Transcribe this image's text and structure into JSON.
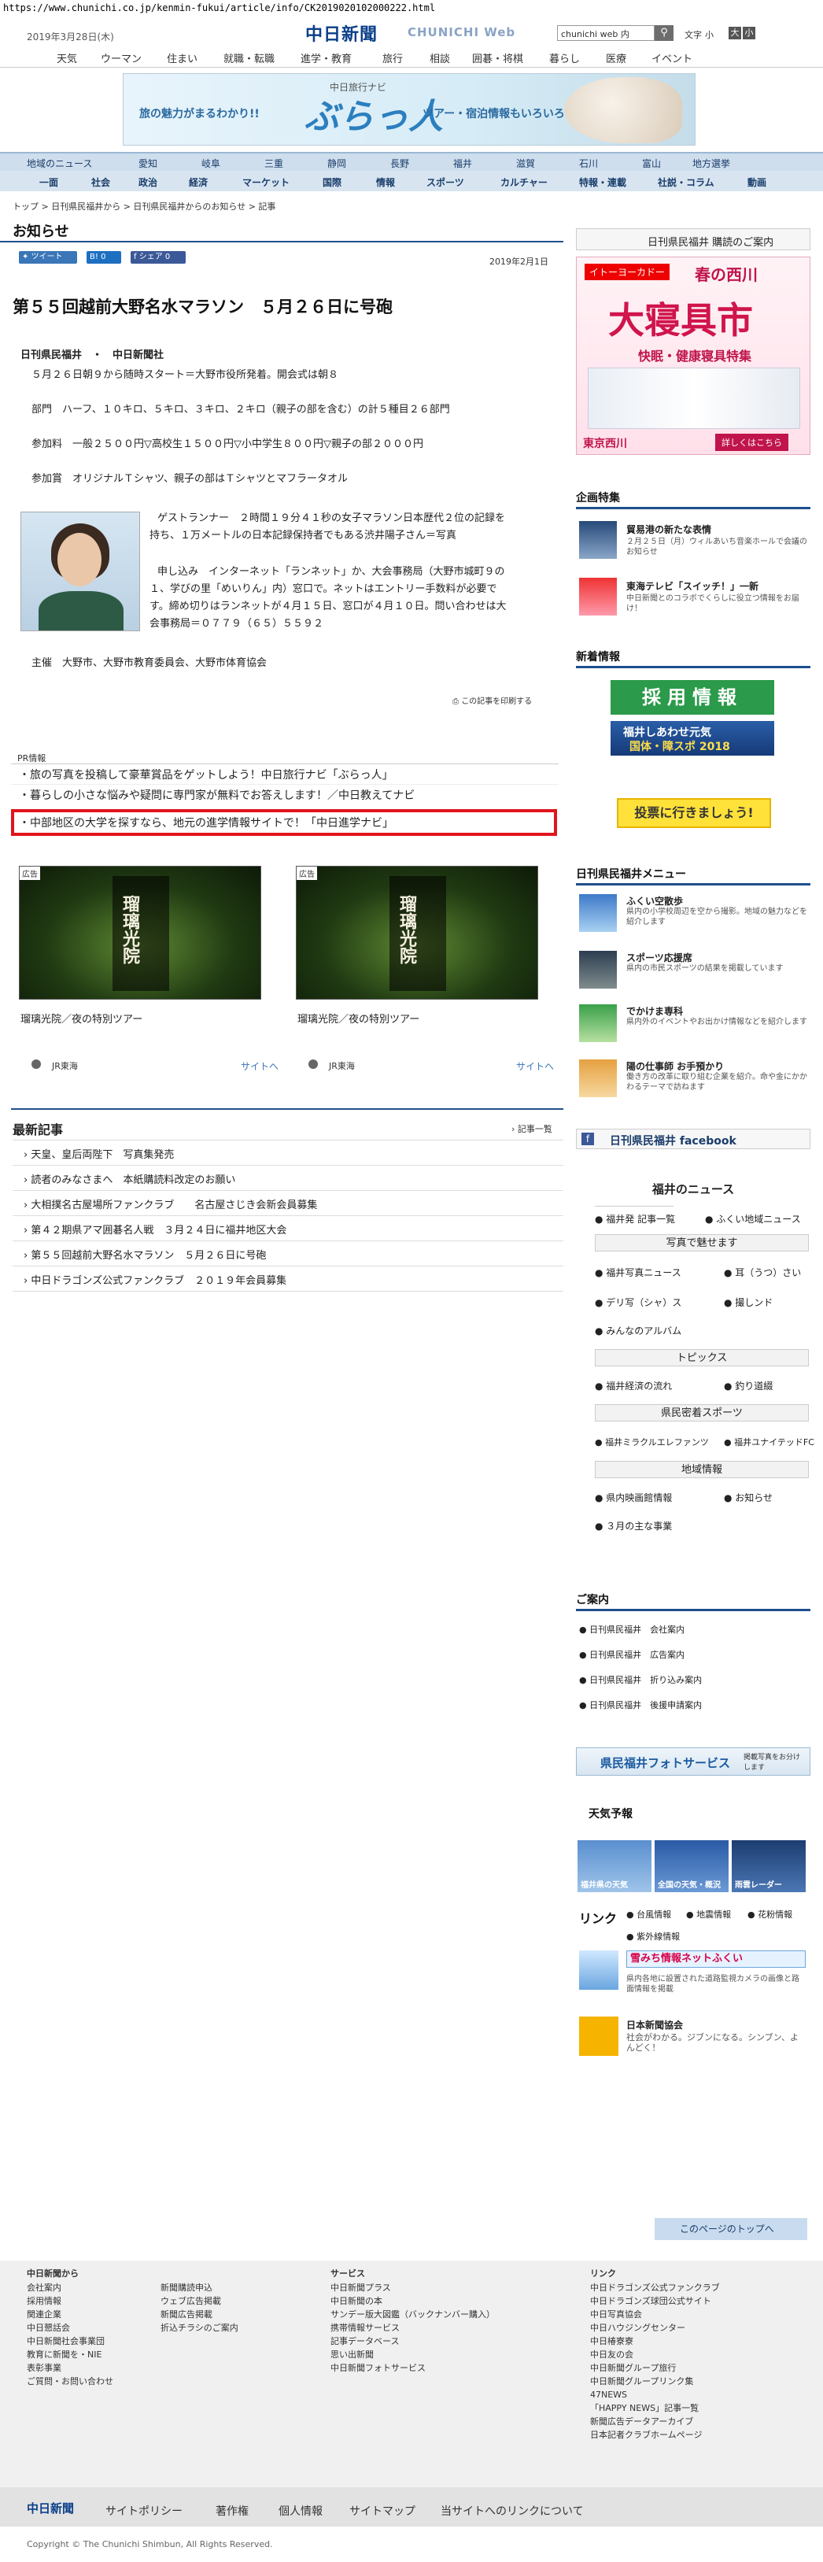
{
  "url": "https://www.chunichi.co.jp/kenmin-fukui/article/info/CK2019020102000222.html",
  "header": {
    "date": "2019年3月28日(木)",
    "logo": "中日新聞",
    "logo_en": "CHUNICHI Web",
    "search_placeholder": "chunichi web 内",
    "font_label": "文字",
    "font_small": "小",
    "font_large": "大"
  },
  "topnav": [
    "天気",
    "ウーマン",
    "住まい",
    "就職・転職",
    "進学・教育",
    "旅行",
    "相談",
    "囲碁・将棋",
    "暮らし",
    "医療",
    "イベント"
  ],
  "banner": {
    "sub": "中日旅行ナビ",
    "main": "ぶらっ人",
    "left": "旅の魅力がまるわかり!!",
    "right": "ツアー・宿泊情報もいろいろ"
  },
  "regnav": {
    "row1": [
      "地域のニュース",
      "愛知",
      "岐阜",
      "三重",
      "静岡",
      "長野",
      "福井",
      "滋賀",
      "石川",
      "富山",
      "地方選挙"
    ],
    "row2": [
      "一面",
      "社会",
      "政治",
      "経済",
      "マーケット",
      "国際",
      "スポーツ",
      "情報",
      "カルチャー",
      "特報・連載",
      "社説・コラム",
      "動画"
    ]
  },
  "breadcrumb": "トップ > 日刊県民福井から > 日刊県民福井からのお知らせ > 記事",
  "page_heading": "お知らせ",
  "share": {
    "tweet": "ツイート",
    "hatena": "0",
    "fb": "シェア 0"
  },
  "article": {
    "date": "2019年2月1日",
    "title": "第５５回越前大野名水マラソン　５月２６日に号砲",
    "byline": "日刊県民福井　・　中日新聞社",
    "p1": "５月２６日朝９から随時スタート＝大野市役所発着。開会式は朝８",
    "p2": "部門　ハーフ、１０キロ、５キロ、３キロ、２キロ（親子の部を含む）の計５種目２６部門",
    "p3": "参加料　一般２５００円▽高校生１５００円▽小中学生８００円▽親子の部２０００円",
    "p4": "参加賞　オリジナルＴシャツ、親子の部はＴシャツとマフラータオル",
    "p5a": "ゲストランナー　２時間１９分４１秒の女子マラソン日本歴代２位の記録を",
    "p5b": "持ち、１万メートルの日本記録保持者でもある渋井陽子さん＝写真",
    "p6a": "申し込み　インターネット「ランネット」か、大会事務局（大野市城町９の",
    "p6b": "１、学びの里「めいりん」内）窓口で。ネットはエントリー手数料が必要で",
    "p6c": "す。締め切りはランネットが４月１５日、窓口が４月１０日。問い合わせは大",
    "p6d": "会事務局＝０７７９（６５）５５９２",
    "p7": "主催　大野市、大野市教育委員会、大野市体育協会",
    "print": "この記事を印刷する"
  },
  "pr": {
    "label": "PR情報",
    "items": [
      "旅の写真を投稿して豪華賞品をゲットしよう！中日旅行ナビ「ぶらっ人」",
      "暮らしの小さな悩みや疑問に専門家が無料でお答えします！／中日教えてナビ",
      "中部地区の大学を探すなら、地元の進学情報サイトで！「中日進学ナビ」"
    ]
  },
  "ads": [
    {
      "tag": "広告",
      "image_text": "瑠璃光院",
      "caption": "瑠璃光院／夜の特別ツアー",
      "sponsor": "JR東海",
      "link": "サイトへ"
    },
    {
      "tag": "広告",
      "image_text": "瑠璃光院",
      "caption": "瑠璃光院／夜の特別ツアー",
      "sponsor": "JR東海",
      "link": "サイトへ"
    }
  ],
  "latest": {
    "heading": "最新記事",
    "more": "記事一覧",
    "items": [
      "天皇、皇后両陛下　写真集発売",
      "読者のみなさまへ　本紙購読料改定のお願い",
      "大相撲名古屋場所ファンクラブ　　名古屋さじき会新会員募集",
      "第４２期県アマ囲碁名人戦　３月２４日に福井地区大会",
      "第５５回越前大野名水マラソン　５月２６日に号砲",
      "中日ドラゴンズ公式ファンクラブ　２０１９年会員募集"
    ]
  },
  "right": {
    "ad1": {
      "top": "イトーヨーカドー",
      "event": "春の西川",
      "big": "大寝具市",
      "sub": "快眠・健康寝具特集",
      "brand": "東京西川",
      "more": "詳しくはこちら"
    },
    "kikaku": {
      "heading": "企画特集",
      "items": [
        {
          "title": "貿易港の新たな表情",
          "desc": "２月２５日（月）ウィルあいち音楽ホールで会議のお知らせ"
        },
        {
          "title": "東海テレビ「スイッチ！」一新",
          "desc": "中日新聞とのコラボでくらしに役立つ情報をお届け！"
        }
      ]
    },
    "shinchaku": {
      "heading": "新着情報",
      "banner1": "採用情報",
      "banner2a": "福井しあわせ元気",
      "banner2b": "国体・障スポ 2018",
      "vote": "投票に行きましょう!"
    },
    "menu": {
      "heading": "日刊県民福井メニュー",
      "items": [
        {
          "title": "ふくい空散歩",
          "desc": "県内の小学校周辺を空から撮影。地域の魅力などを紹介します"
        },
        {
          "title": "スポーツ応援席",
          "desc": "県内の市民スポーツの結果を掲載しています"
        },
        {
          "title": "でかけま専科",
          "desc": "県内外のイベントやお出かけ情報などを紹介します"
        },
        {
          "title": "陽の仕事師 お手預かり",
          "desc": "働き方の改革に取り組む企業を紹介。命や金にかかわるテーマで訪ねます"
        }
      ],
      "facebook": "日刊県民福井 facebook"
    },
    "fukui": {
      "heading": "福井のニュース",
      "row1": [
        "福井発 記事一覧",
        "ふくい地域ニュース"
      ],
      "sec_photo": "写真で魅せます",
      "photo_items": [
        "福井写真ニュース",
        "耳（うつ）さい",
        "デリ写（シャ）ス",
        "撮しンド",
        "みんなのアルバム"
      ],
      "sec_topics": "トピックス",
      "topic_items": [
        "福井経済の流れ",
        "釣り道綴"
      ],
      "sec_sports": "県民密着スポーツ",
      "sports_items": [
        "福井ミラクルエレファンツ",
        "福井ユナイテッドFC"
      ],
      "sec_local": "地域情報",
      "local_items": [
        "県内映画館情報",
        "お知らせ",
        "３月の主な事業"
      ]
    },
    "annai": {
      "heading": "ご案内",
      "items": [
        "日刊県民福井　会社案内",
        "日刊県民福井　広告案内",
        "日刊県民福井　折り込み案内",
        "日刊県民福井　後援申請案内"
      ]
    },
    "photo_service": "県民福井フォトサービス",
    "photo_service_sub": "掲載写真をお分けします",
    "weather": {
      "heading": "天気予報",
      "tiles": [
        "福井県の天気",
        "全国の天気・概況",
        "雨雲レーダー"
      ]
    },
    "links": {
      "heading": "リンク",
      "items": [
        "台風情報",
        "地震情報",
        "花粉情報",
        "紫外線情報"
      ],
      "l1_title": "雪みち情報ネットふくい",
      "l1_desc": "県内各地に設置された道路監視カメラの画像と路面情報を掲載",
      "l2_title": "日本新聞協会",
      "l2_desc": "社会がわかる。ジブンになる。シンブン、よんどく！"
    }
  },
  "totop": "このページのトップへ",
  "footer": {
    "col1_h": "中日新聞から",
    "col1": [
      "会社案内",
      "採用情報",
      "関連企業",
      "中日懇話会",
      "中日新聞社会事業団",
      "教育に新聞を・NIE",
      "表彰事業",
      "ご質問・お問い合わせ"
    ],
    "col2": [
      "新聞購読申込",
      "ウェブ広告掲載",
      "新聞広告掲載",
      "折込チラシのご案内"
    ],
    "col3_h": "サービス",
    "col3": [
      "中日新聞プラス",
      "中日新聞の本",
      "サンデー版大図鑑（バックナンバー購入）",
      "携帯情報サービス",
      "記事データベース",
      "思い出新聞",
      "中日新聞フォトサービス"
    ],
    "col4_h": "リンク",
    "col4": [
      "中日ドラゴンズ公式ファンクラブ",
      "中日ドラゴンズ球団公式サイト",
      "中日写真協会",
      "中日ハウジングセンター",
      "中日椿寮寮",
      "中日友の会",
      "中日新聞グループ旅行",
      "中日新聞グループリンク集",
      "47NEWS",
      "「HAPPY NEWS」記事一覧",
      "新聞広告データアーカイブ",
      "日本記者クラブホームページ"
    ],
    "bottom_logo": "中日新聞",
    "bottom_links": [
      "サイトポリシー",
      "著作権",
      "個人情報",
      "サイトマップ",
      "当サイトへのリンクについて"
    ],
    "copyright": "Copyright © The Chunichi Shimbun, All Rights Reserved."
  }
}
